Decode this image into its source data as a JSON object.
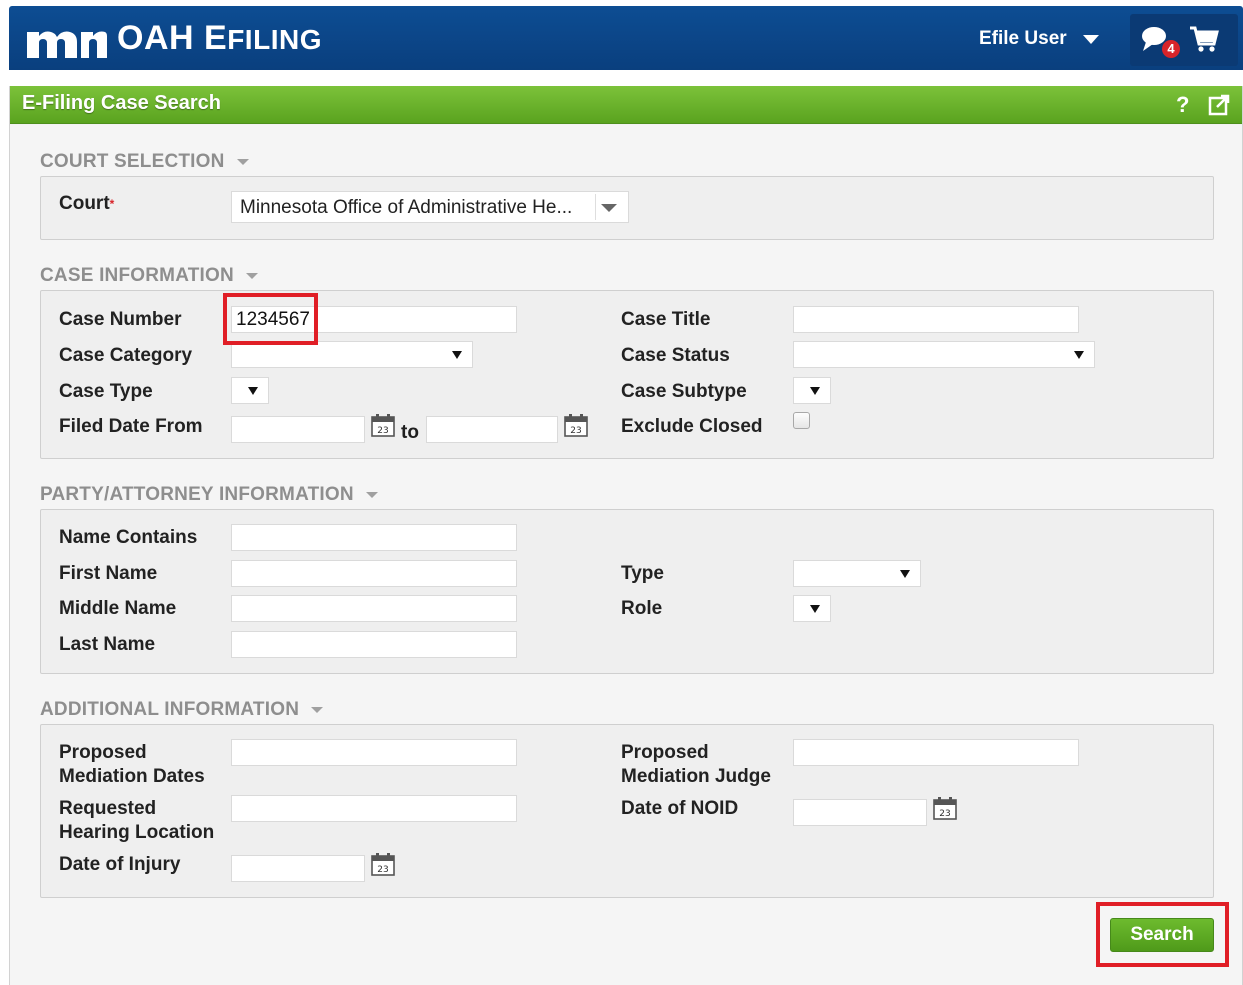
{
  "header": {
    "brand_mark": "mn",
    "brand_oah": "OAH",
    "brand_e": "E",
    "brand_filing": "FILING",
    "user_label": "Efile User",
    "notification_count": "4"
  },
  "panel": {
    "title": "E-Filing Case Search",
    "help_label": "?"
  },
  "court_selection": {
    "title": "COURT SELECTION",
    "court_label": "Court",
    "required_mark": "*",
    "court_value": "Minnesota Office of Administrative He..."
  },
  "case_information": {
    "title": "CASE INFORMATION",
    "case_number_label": "Case Number",
    "case_number_value": "1234567",
    "case_title_label": "Case Title",
    "case_category_label": "Case Category",
    "case_status_label": "Case Status",
    "case_type_label": "Case Type",
    "case_subtype_label": "Case Subtype",
    "filed_date_from_label": "Filed Date From",
    "to_label": "to",
    "exclude_closed_label": "Exclude Closed"
  },
  "party_attorney": {
    "title": "PARTY/ATTORNEY INFORMATION",
    "name_contains_label": "Name Contains",
    "first_name_label": "First Name",
    "type_label": "Type",
    "middle_name_label": "Middle Name",
    "role_label": "Role",
    "last_name_label": "Last Name"
  },
  "additional": {
    "title": "ADDITIONAL INFORMATION",
    "proposed_mediation_dates_line1": "Proposed",
    "proposed_mediation_dates_line2": "Mediation Dates",
    "proposed_mediation_judge_line1": "Proposed",
    "proposed_mediation_judge_line2": "Mediation Judge",
    "requested_hearing_location_line1": "Requested",
    "requested_hearing_location_line2": "Hearing Location",
    "date_of_noid_label": "Date of NOID",
    "date_of_injury_label": "Date of Injury",
    "calendar_day": "23"
  },
  "actions": {
    "search_label": "Search"
  },
  "colors": {
    "header_blue": "#0d4d93",
    "panel_green": "#6dbb2e",
    "highlight_red": "#e01e26"
  }
}
